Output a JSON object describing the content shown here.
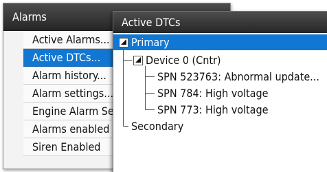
{
  "alarms_window": {
    "title": "Alarms",
    "menu_items": [
      {
        "label": "Active Alarms..."
      },
      {
        "label": "Active DTCs...",
        "selected": true
      },
      {
        "label": "Alarm history..."
      },
      {
        "label": "Alarm settings..."
      },
      {
        "label": "Engine Alarm Set"
      },
      {
        "label": "Alarms enabled"
      },
      {
        "label": "Siren Enabled"
      }
    ]
  },
  "dtc_window": {
    "title": "Active DTCs",
    "tree": {
      "primary": "Primary",
      "device": "Device 0 (Cntr)",
      "spns": [
        "SPN 523763: Abnormal update...",
        "SPN 784: High voltage",
        "SPN 773: High voltage"
      ],
      "secondary": "Secondary"
    }
  },
  "colors": {
    "selection": "#1177d2",
    "titlebar": "#333333"
  },
  "icons": {
    "expanded_node": "triangle-down-icon"
  }
}
